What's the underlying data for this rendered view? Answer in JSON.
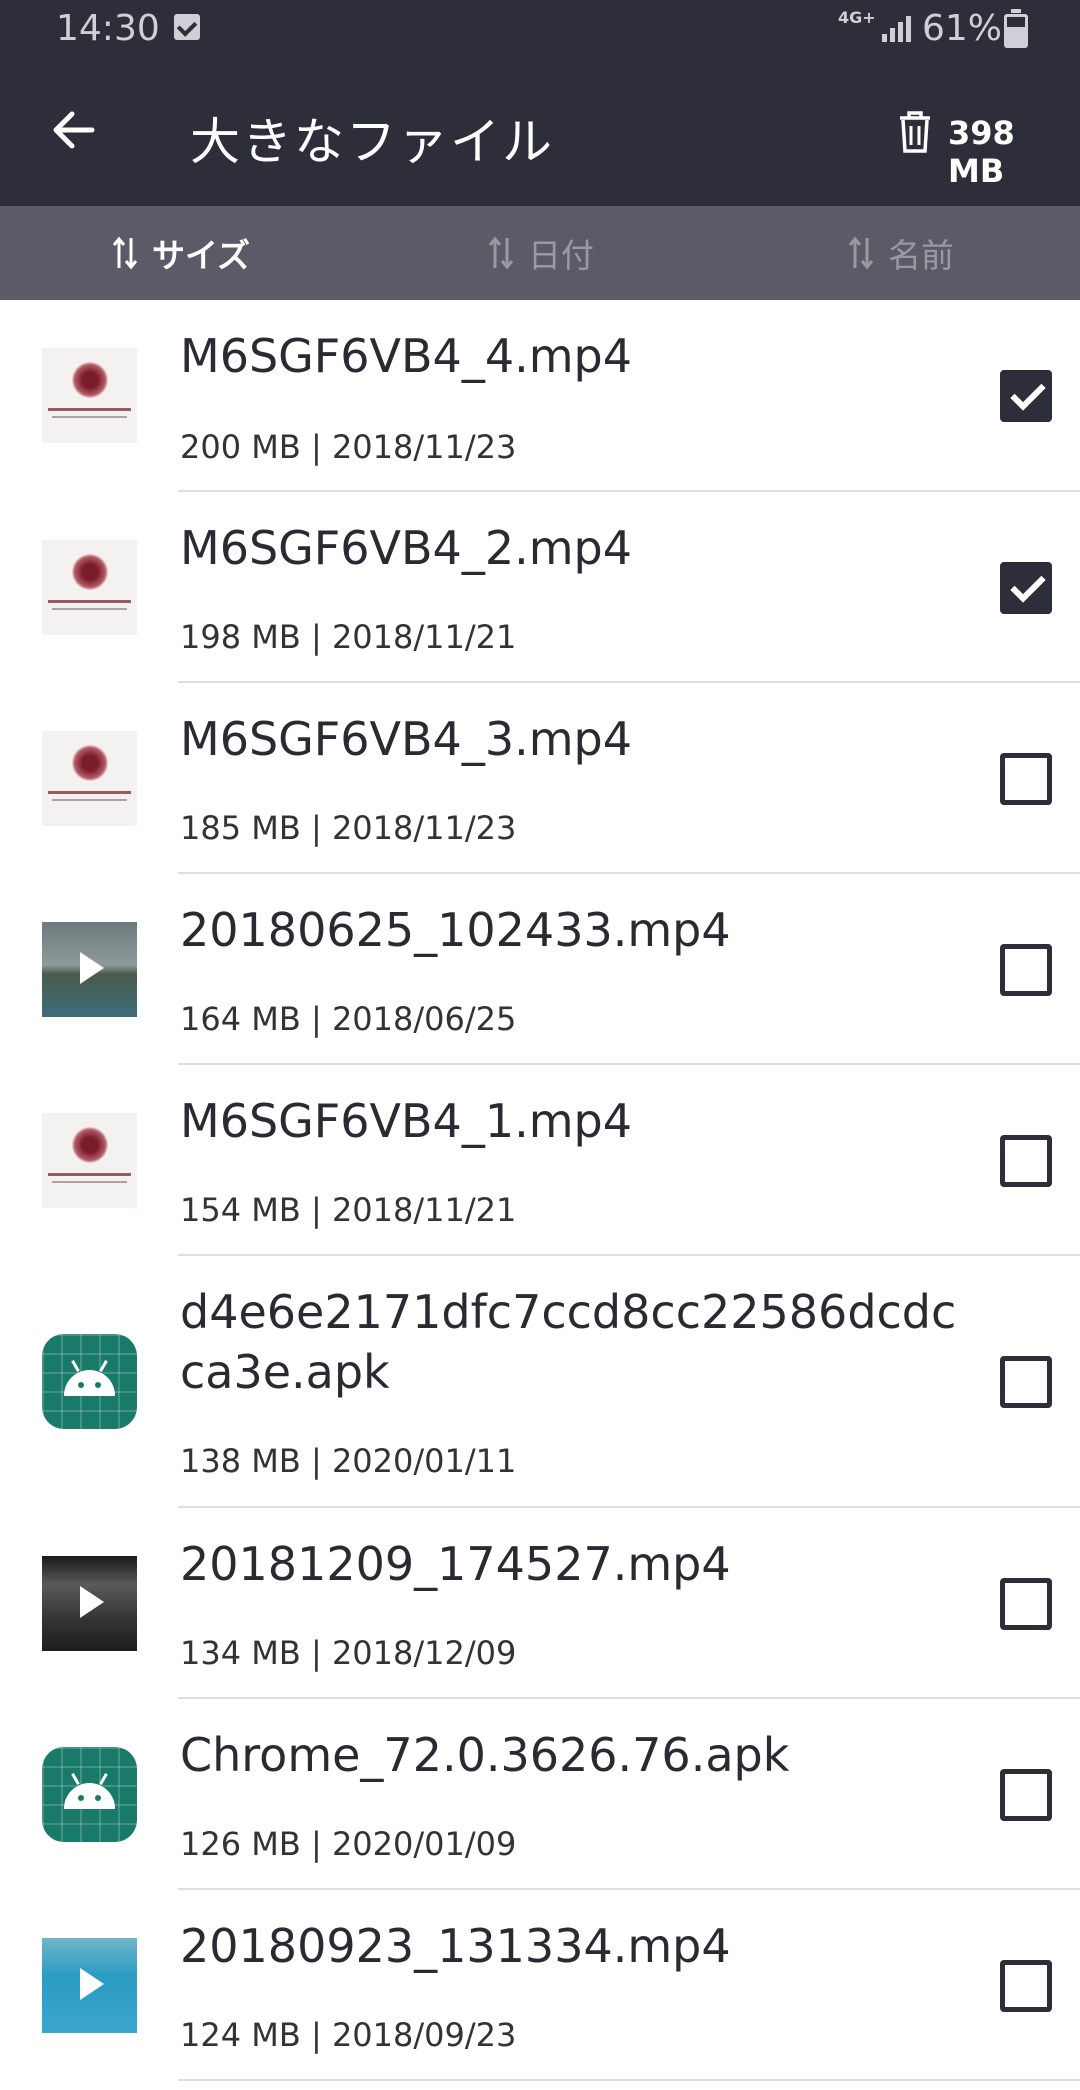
{
  "status_bar": {
    "time": "14:30",
    "network": "4G+",
    "battery_percent": "61%"
  },
  "header": {
    "title": "大きなファイル",
    "selected_size": "398 MB"
  },
  "sort_tabs": [
    {
      "label": "サイズ",
      "active": true
    },
    {
      "label": "日付",
      "active": false
    },
    {
      "label": "名前",
      "active": false
    }
  ],
  "files": [
    {
      "name": "M6SGF6VB4_4.mp4",
      "meta": "200 MB | 2018/11/23",
      "checked": true,
      "thumb": "stanford-thumbnail"
    },
    {
      "name": "M6SGF6VB4_2.mp4",
      "meta": "198 MB | 2018/11/21",
      "checked": true,
      "thumb": "stanford-thumbnail"
    },
    {
      "name": "M6SGF6VB4_3.mp4",
      "meta": "185 MB | 2018/11/23",
      "checked": false,
      "thumb": "stanford-thumbnail"
    },
    {
      "name": "20180625_102433.mp4",
      "meta": "164 MB | 2018/06/25",
      "checked": false,
      "thumb": "video-thumbnail"
    },
    {
      "name": "M6SGF6VB4_1.mp4",
      "meta": "154 MB | 2018/11/21",
      "checked": false,
      "thumb": "stanford-thumbnail"
    },
    {
      "name": "d4e6e2171dfc7ccd8cc22586dcdcca3e.apk",
      "name_line1": "d4e6e2171dfc7ccd8cc22586dcdc",
      "name_line2": "ca3e.apk",
      "meta": "138 MB | 2020/01/11",
      "checked": false,
      "thumb": "android-icon"
    },
    {
      "name": "20181209_174527.mp4",
      "meta": "134 MB | 2018/12/09",
      "checked": false,
      "thumb": "video-thumbnail"
    },
    {
      "name": "Chrome_72.0.3626.76.apk",
      "meta": "126 MB | 2020/01/09",
      "checked": false,
      "thumb": "android-icon"
    },
    {
      "name": "20180923_131334.mp4",
      "meta": "124 MB | 2018/09/23",
      "checked": false,
      "thumb": "video-thumbnail"
    }
  ],
  "colors": {
    "header_bg": "#2e2d3a",
    "sort_bar_bg": "#5b5a66",
    "checkbox": "#2e2d3a"
  }
}
